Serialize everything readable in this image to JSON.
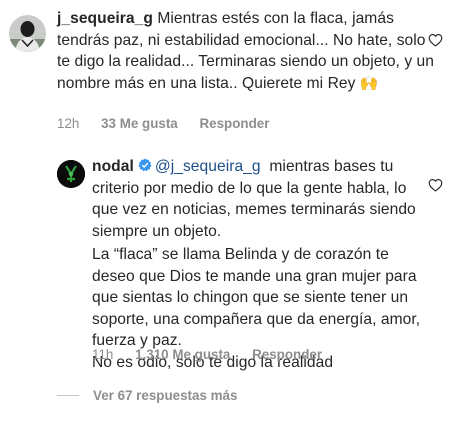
{
  "comments": [
    {
      "username": "j_sequeira_g",
      "text": "Mientras estés con la flaca, jamás tendrás paz, ni estabilidad emocional... No hate, solo te digo la realidad... Terminaras siendo un objeto, y un nombre más en una lista.. Quierete mi Rey",
      "emoji": "🙌",
      "time": "12h",
      "likes": "33 Me gusta",
      "reply_label": "Responder"
    },
    {
      "username": "nodal",
      "mention": "@j_sequeira_g",
      "text": "mientras bases tu criterio por medio de lo que la gente habla, lo que vez en noticias, memes terminarás siendo siempre un objeto.",
      "text2": "La “flaca” se llama Belinda y de corazón te deseo que Dios te mande una gran mujer para que sientas lo chingon que se siente tener un soporte, una compañera que da energía, amor, fuerza y paz.",
      "text3": "No es odio, solo te digo la realidad",
      "time": "11h",
      "likes": "1,310 Me gusta",
      "reply_label": "Responder"
    }
  ],
  "view_more_replies": "Ver 67 respuestas más",
  "icons": {
    "like": "heart-outline-icon",
    "verified": "verified-badge-icon"
  },
  "colors": {
    "mention": "#1f4f8a",
    "verified": "#3897f0",
    "meta": "#8e8e8e"
  }
}
